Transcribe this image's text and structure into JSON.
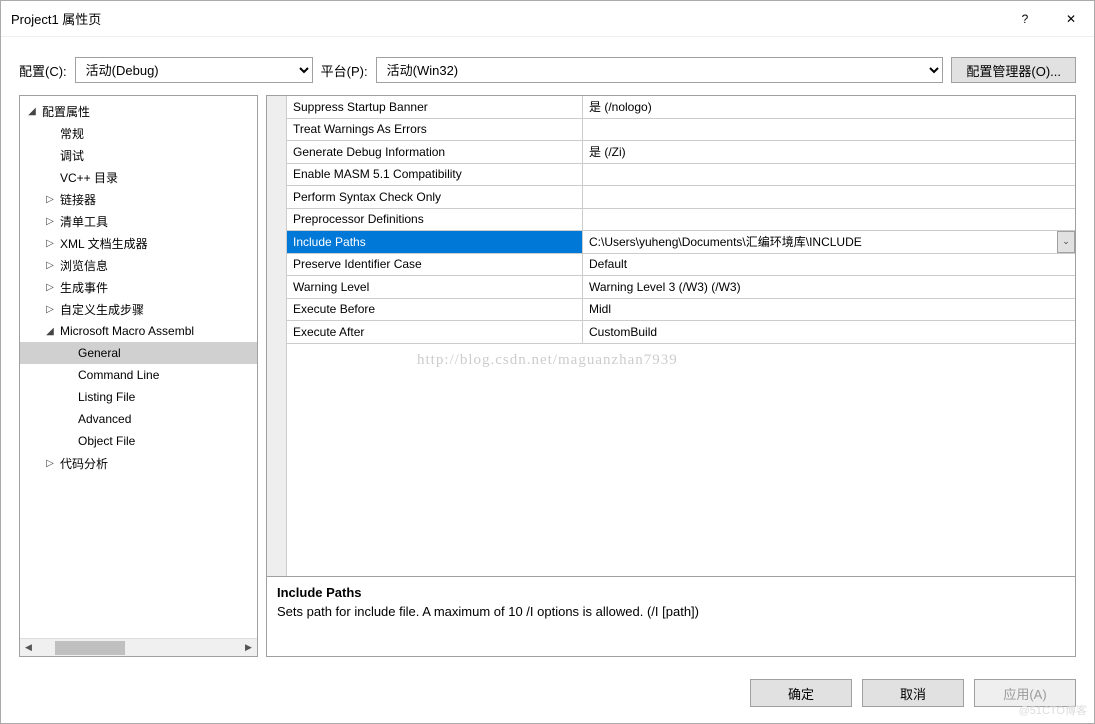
{
  "window": {
    "title": "Project1 属性页",
    "help_icon": "?",
    "close_icon": "✕"
  },
  "topbar": {
    "config_label": "配置(C):",
    "config_value": "活动(Debug)",
    "platform_label": "平台(P):",
    "platform_value": "活动(Win32)",
    "config_manager": "配置管理器(O)..."
  },
  "tree": [
    {
      "indent": 0,
      "arrow": "◢",
      "label": "配置属性",
      "name": "config-properties"
    },
    {
      "indent": 1,
      "arrow": "",
      "label": "常规",
      "name": "general-cfg"
    },
    {
      "indent": 1,
      "arrow": "",
      "label": "调试",
      "name": "debugging"
    },
    {
      "indent": 1,
      "arrow": "",
      "label": "VC++ 目录",
      "name": "vcpp-dirs"
    },
    {
      "indent": 1,
      "arrow": "▷",
      "label": "链接器",
      "name": "linker"
    },
    {
      "indent": 1,
      "arrow": "▷",
      "label": "清单工具",
      "name": "manifest-tool"
    },
    {
      "indent": 1,
      "arrow": "▷",
      "label": "XML 文档生成器",
      "name": "xml-doc"
    },
    {
      "indent": 1,
      "arrow": "▷",
      "label": "浏览信息",
      "name": "browse-info"
    },
    {
      "indent": 1,
      "arrow": "▷",
      "label": "生成事件",
      "name": "build-events"
    },
    {
      "indent": 1,
      "arrow": "▷",
      "label": "自定义生成步骤",
      "name": "custom-build-step"
    },
    {
      "indent": 1,
      "arrow": "◢",
      "label": "Microsoft Macro Assembl",
      "name": "masm"
    },
    {
      "indent": 2,
      "arrow": "",
      "label": "General",
      "name": "masm-general",
      "selected": true
    },
    {
      "indent": 2,
      "arrow": "",
      "label": "Command Line",
      "name": "masm-cmdline"
    },
    {
      "indent": 2,
      "arrow": "",
      "label": "Listing File",
      "name": "masm-listing"
    },
    {
      "indent": 2,
      "arrow": "",
      "label": "Advanced",
      "name": "masm-advanced"
    },
    {
      "indent": 2,
      "arrow": "",
      "label": "Object File",
      "name": "masm-object"
    },
    {
      "indent": 1,
      "arrow": "▷",
      "label": "代码分析",
      "name": "code-analysis"
    }
  ],
  "grid": [
    {
      "name": "Suppress Startup Banner",
      "value": "是 (/nologo)"
    },
    {
      "name": "Treat Warnings As Errors",
      "value": ""
    },
    {
      "name": "Generate Debug Information",
      "value": "是 (/Zi)"
    },
    {
      "name": "Enable MASM 5.1 Compatibility",
      "value": ""
    },
    {
      "name": "Perform Syntax Check Only",
      "value": ""
    },
    {
      "name": "Preprocessor Definitions",
      "value": ""
    },
    {
      "name": "Include Paths",
      "value": "C:\\Users\\yuheng\\Documents\\汇编环境库\\INCLUDE",
      "selected": true
    },
    {
      "name": "Preserve Identifier Case",
      "value": "Default"
    },
    {
      "name": "Warning Level",
      "value": "Warning Level 3 (/W3) (/W3)"
    },
    {
      "name": "Execute Before",
      "value": "Midl"
    },
    {
      "name": "Execute After",
      "value": "CustomBuild"
    }
  ],
  "watermark": "http://blog.csdn.net/maguanzhan7939",
  "desc": {
    "title": "Include Paths",
    "text": "Sets path for include file. A maximum of 10 /I options is allowed.     (/I [path])"
  },
  "footer": {
    "ok": "确定",
    "cancel": "取消",
    "apply": "应用(A)"
  },
  "corner_watermark": "@51CTO博客"
}
